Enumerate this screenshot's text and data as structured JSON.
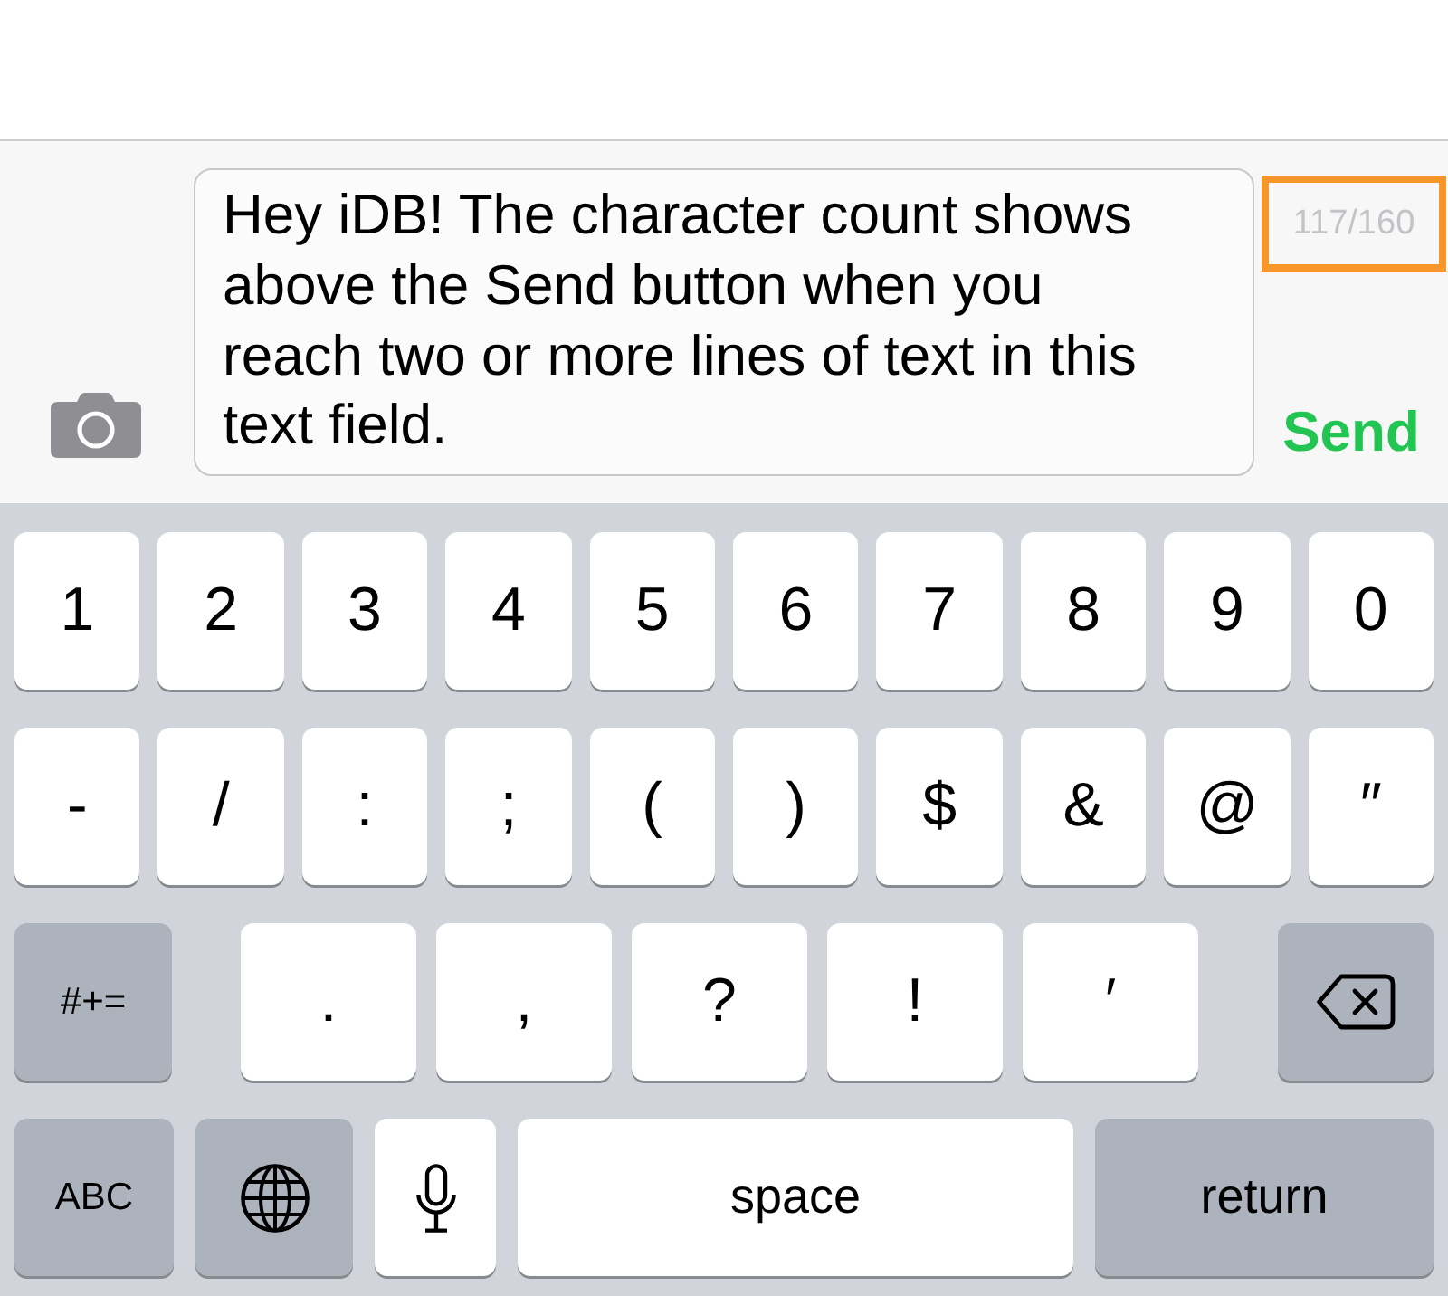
{
  "composer": {
    "message": "Hey iDB! The character count shows above the Send button when you reach two or more lines of text in this text field.",
    "character_count": "117/160",
    "count_highlighted": true,
    "send_label": "Send"
  },
  "keyboard": {
    "rows": [
      {
        "kind": "full",
        "keys": [
          {
            "kind": "char",
            "label": "1"
          },
          {
            "kind": "char",
            "label": "2"
          },
          {
            "kind": "char",
            "label": "3"
          },
          {
            "kind": "char",
            "label": "4"
          },
          {
            "kind": "char",
            "label": "5"
          },
          {
            "kind": "char",
            "label": "6"
          },
          {
            "kind": "char",
            "label": "7"
          },
          {
            "kind": "char",
            "label": "8"
          },
          {
            "kind": "char",
            "label": "9"
          },
          {
            "kind": "char",
            "label": "0"
          }
        ]
      },
      {
        "kind": "full",
        "keys": [
          {
            "kind": "char",
            "label": "-"
          },
          {
            "kind": "char",
            "label": "/"
          },
          {
            "kind": "char",
            "label": ":"
          },
          {
            "kind": "char",
            "label": ";"
          },
          {
            "kind": "char",
            "label": "("
          },
          {
            "kind": "char",
            "label": ")"
          },
          {
            "kind": "char",
            "label": "$"
          },
          {
            "kind": "char",
            "label": "&"
          },
          {
            "kind": "char",
            "label": "@"
          },
          {
            "kind": "char",
            "label": "″"
          }
        ]
      },
      {
        "kind": "punctuation",
        "keys": [
          {
            "kind": "mode",
            "label": "#+="
          },
          {
            "kind": "char",
            "label": "."
          },
          {
            "kind": "char",
            "label": ","
          },
          {
            "kind": "char",
            "label": "?"
          },
          {
            "kind": "char",
            "label": "!"
          },
          {
            "kind": "char",
            "label": "′"
          },
          {
            "kind": "delete"
          }
        ]
      },
      {
        "kind": "bottom",
        "keys": [
          {
            "kind": "mode",
            "label": "ABC"
          },
          {
            "kind": "globe"
          },
          {
            "kind": "mic"
          },
          {
            "kind": "space",
            "label": "space"
          },
          {
            "kind": "return",
            "label": "return"
          }
        ]
      }
    ]
  }
}
